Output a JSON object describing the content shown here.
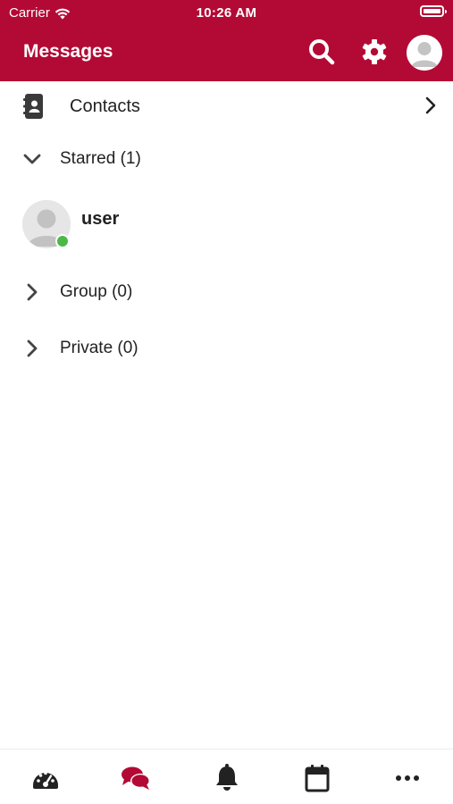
{
  "status_bar": {
    "carrier": "Carrier",
    "time": "10:26 AM"
  },
  "header": {
    "title": "Messages"
  },
  "contacts": {
    "label": "Contacts"
  },
  "sections": {
    "starred": {
      "label": "Starred (1)",
      "expanded": true
    },
    "group": {
      "label": "Group (0)",
      "expanded": false
    },
    "private": {
      "label": "Private (0)",
      "expanded": false
    }
  },
  "starred_users": [
    {
      "name": "user",
      "status": "online"
    }
  ],
  "tabs": [
    {
      "icon": "dashboard-icon",
      "active": false
    },
    {
      "icon": "messages-icon",
      "active": true
    },
    {
      "icon": "bell-icon",
      "active": false
    },
    {
      "icon": "calendar-icon",
      "active": false
    },
    {
      "icon": "more-icon",
      "active": false
    }
  ],
  "colors": {
    "brand": "#b30a35",
    "online": "#4cb848",
    "icon": "#222222"
  }
}
